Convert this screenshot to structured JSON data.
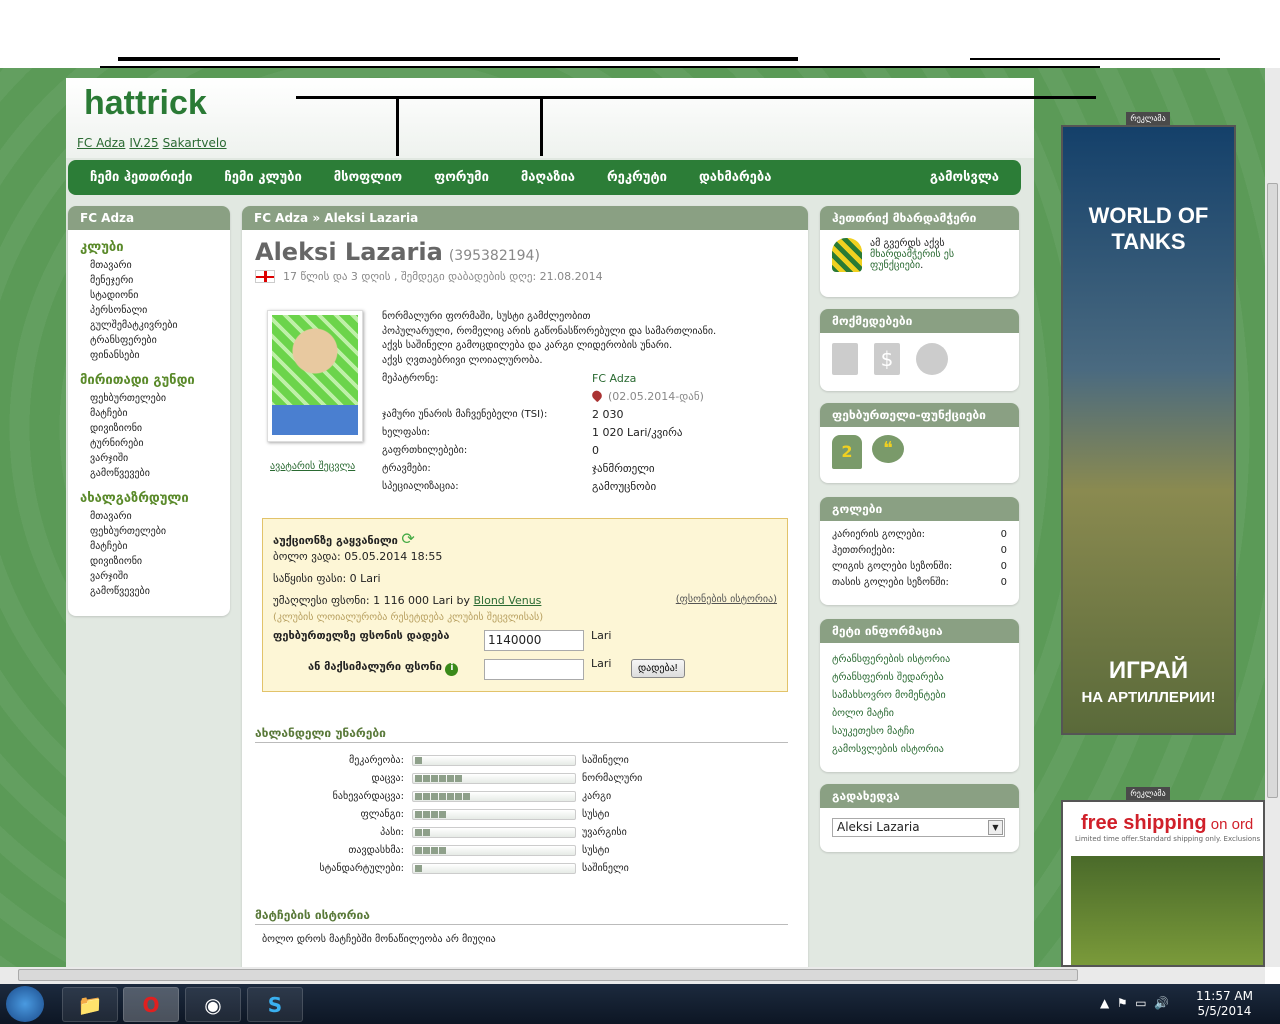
{
  "header": {
    "breadcrumb": [
      "FC Adza",
      "IV.25",
      "Sakartvelo"
    ]
  },
  "nav": [
    "ჩემი ჰეთთრიქი",
    "ჩემი კლუბი",
    "მსოფლიო",
    "ფორუმი",
    "მაღაზია",
    "რეკრუტი",
    "დახმარება"
  ],
  "nav_logout": "გამოსვლა",
  "left": {
    "title": "FC Adza",
    "groups": [
      {
        "title": "კლუბი",
        "items": [
          "მთავარი",
          "მენეჯერი",
          "სტადიონი",
          "პერსონალი",
          "გულშემატკივრები",
          "ტრანსფერები",
          "ფინანსები"
        ]
      },
      {
        "title": "მირითადი გუნდი",
        "items": [
          "ფეხბურთელები",
          "მატჩები",
          "დივიზიონი",
          "ტურნირები",
          "ვარჯიში",
          "გამოწვევები"
        ]
      },
      {
        "title": "ახალგაზრდული",
        "items": [
          "მთავარი",
          "ფეხბურთელები",
          "მატჩები",
          "დივიზიონი",
          "ვარჯიში",
          "გამოწვევები"
        ]
      }
    ]
  },
  "main": {
    "crumb_club": "FC Adza",
    "crumb_sep": "»",
    "crumb_player": "Aleksi Lazaria",
    "name": "Aleksi Lazaria",
    "id": "(395382194)",
    "age": "17 წლის და 3 დღის , შემდეგი დაბადების დღე: 21.08.2014",
    "avatar_link": "ავატარის შეცვლა",
    "description": [
      "ნორმალური ფორმაში, სუსტი გამძლეობით",
      "პოპულარული, რომელიც არის გაწონასწორებული და სამართლიანი.",
      "აქვს საშინელი გამოცდილება და კარგი ლიდერობის უნარი.",
      "აქვს ღვთაებრივი ლოიალურობა."
    ],
    "owner_label": "მეპატრონე:",
    "owner": "FC Adza",
    "owner_since": "(02.05.2014-დან)",
    "rows": [
      {
        "k": "ჯამური უნარის მაჩვენებელი (TSI):",
        "v": "2 030"
      },
      {
        "k": "ხელფასი:",
        "v": "1 020 Lari/კვირა"
      },
      {
        "k": "გაფრთხილებები:",
        "v": "0"
      },
      {
        "k": "ტრავმები:",
        "v": "ჯანმრთელი"
      },
      {
        "k": "სპეციალიზაცია:",
        "v": "გამოუცნობი"
      }
    ],
    "auction": {
      "title": "აუქციონზე გაყვანილი",
      "deadline": "ბოლო ვადა: 05.05.2014 18:55",
      "start_price": "საწყისი ფასი: 0 Lari",
      "top_bid": "უმაღლესი ფსონი: 1 116 000 Lari by ",
      "top_bidder": "Blond Venus",
      "history": "(ფსონების ისტორია)",
      "note": "(კლუბის ლოიალურობა რესეტდება კლუბის შეცვლისას)",
      "bid_label": "ფეხბურთელზე ფსონის დადება",
      "bid_value": "1140000",
      "max_label": "ან მაქსიმალური ფსონი",
      "max_value": "",
      "currency": "Lari",
      "submit": "დადება!"
    },
    "skills_title": "ახლანდელი უნარები",
    "skills": [
      {
        "name": "მეკარეობა:",
        "level": 1,
        "text": "საშინელი"
      },
      {
        "name": "დაცვა:",
        "level": 6,
        "text": "ნორმალური"
      },
      {
        "name": "ნახევარდაცვა:",
        "level": 7,
        "text": "კარგი"
      },
      {
        "name": "ფლანგი:",
        "level": 4,
        "text": "სუსტი"
      },
      {
        "name": "პასი:",
        "level": 2,
        "text": "უვარგისი"
      },
      {
        "name": "თავდასხმა:",
        "level": 4,
        "text": "სუსტი"
      },
      {
        "name": "სტანდარტულები:",
        "level": 1,
        "text": "საშინელი"
      }
    ],
    "history_title": "მატჩების ისტორია",
    "history_text": "ბოლო დროს მატჩებში მონაწილეობა არ მიუღია"
  },
  "right": {
    "supporter": {
      "title": "ჰეთთრიქ მხარდამჭერი",
      "text": "ამ გვერდს აქვს ",
      "link": "მხარდამჭერის ეს ფუნქციები",
      "end": "."
    },
    "actions": {
      "title": "მოქმედებები"
    },
    "player_functions": {
      "title": "ფეხბურთელი-ფუნქციები"
    },
    "goals": {
      "title": "გოლები",
      "rows": [
        {
          "k": "კარიერის გოლები:",
          "v": "0"
        },
        {
          "k": "ჰეთთრიქები:",
          "v": "0"
        },
        {
          "k": "ლიგის გოლები სეზონში:",
          "v": "0"
        },
        {
          "k": "თასის გოლები სეზონში:",
          "v": "0"
        }
      ]
    },
    "more": {
      "title": "მეტი ინფორმაცია",
      "links": [
        "ტრანსფერების ისტორია",
        "ტრანსფერის შედარება",
        "სამახსოვრო მომენტები",
        "ბოლო მატჩი",
        "საუკეთესო მატჩი",
        "გამოსვლების ისტორია"
      ]
    },
    "jump": {
      "title": "გადახედვა",
      "selected": "Aleksi Lazaria"
    }
  },
  "ads": {
    "tag": "რეკლამა",
    "ad1_brand": "WORLD OF TANKS",
    "ad1_cta1": "ИГРАЙ",
    "ad1_cta2": "НА АРТИЛЛЕРИИ!",
    "ad2_head": "free shipping",
    "ad2_tail": " on ord",
    "ad2_sub": "Limited time offer.Standard shipping only. Exclusions"
  },
  "taskbar": {
    "time": "11:57 AM",
    "date": "5/5/2014"
  },
  "colors": {
    "nav": "#2c7d37",
    "panel_header": "#8aa083",
    "auction_bg": "#fdf6d6",
    "background": "#5b9a57"
  }
}
